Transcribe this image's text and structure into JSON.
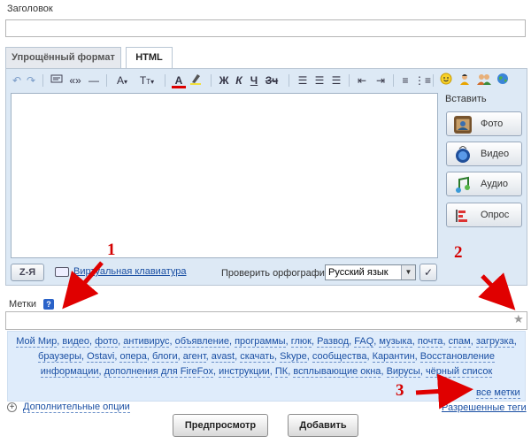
{
  "title": {
    "label": "Заголовок",
    "value": ""
  },
  "tabs": [
    {
      "label": "Упрощённый формат"
    },
    {
      "label": "HTML"
    }
  ],
  "toolbar": {
    "icons": [
      "undo-icon",
      "redo-icon",
      "cut-icon",
      "quote-icon",
      "dash-icon",
      "font-size-icon",
      "text-size-icon",
      "font-color-icon",
      "highlight-icon",
      "bold-icon",
      "italic-icon",
      "underline-icon",
      "strikethrough-icon",
      "align-left-icon",
      "align-center-icon",
      "align-right-icon",
      "outdent-icon",
      "indent-icon",
      "ordered-list-icon",
      "unordered-list-icon",
      "smiley-icon",
      "user-icon",
      "group-icon",
      "globe-icon"
    ],
    "glyphs": {
      "quote": "«»",
      "dash": "—",
      "bold": "Ж",
      "italic": "К",
      "underline": "Ч",
      "strike": "Зч"
    }
  },
  "insert": {
    "label": "Вставить",
    "buttons": [
      {
        "label": "Фото"
      },
      {
        "label": "Видео"
      },
      {
        "label": "Аудио"
      },
      {
        "label": "Опрос"
      }
    ]
  },
  "editor_bar": {
    "zya_label": "Z-Я",
    "keyboard_link": "Виртуальная клавиатура",
    "spellcheck_label": "Проверить орфографию",
    "language": "Русский язык"
  },
  "tags": {
    "label": "Метки",
    "help": "?",
    "value": "",
    "cloud": [
      "Мой Мир",
      "видео",
      "фото",
      "антивирус",
      "объявление",
      "программы",
      "глюк",
      "Развод",
      "FAQ",
      "музыка",
      "почта",
      "спам",
      "загрузка",
      "браузеры",
      "Ostavi",
      "опера",
      "блоги",
      "агент",
      "avast",
      "скачать",
      "Skype",
      "сообщества",
      "Карантин",
      "Восстановление информации",
      "дополнения для FireFox",
      "инструкции",
      "ПК",
      "всплывающие окна",
      "Вирусы",
      "чёрный список"
    ],
    "all_tags": "все метки"
  },
  "more_options": "Дополнительные опции",
  "allowed_tags": "Разрешенные теги",
  "buttons": {
    "preview": "Предпросмотр",
    "add": "Добавить"
  },
  "annotations": [
    "1",
    "2",
    "3"
  ],
  "colors": {
    "link": "#1a4fa3",
    "panel": "#dfecfb",
    "annotation": "#d40000"
  }
}
